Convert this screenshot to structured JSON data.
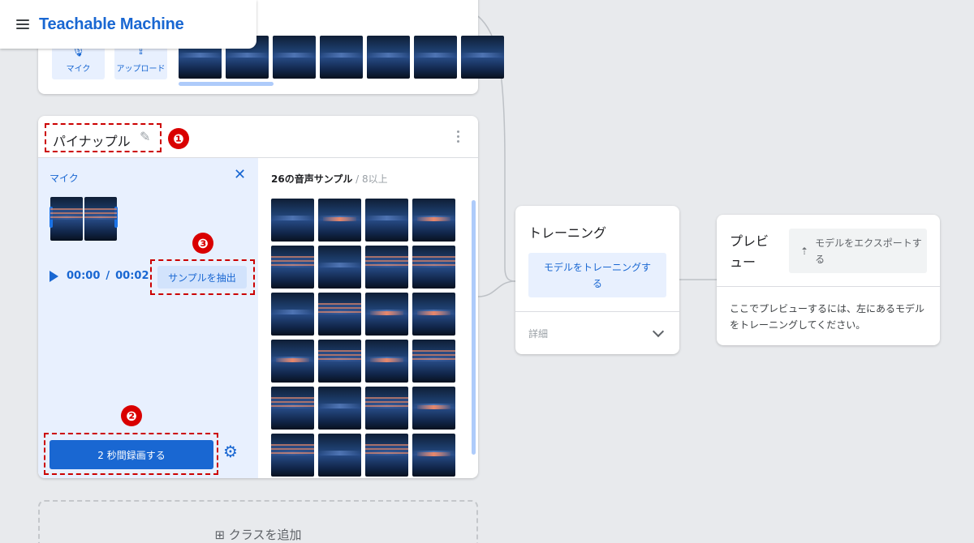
{
  "app": {
    "brand": "Teachable Machine"
  },
  "top_card": {
    "mic_label": "マイク",
    "upload_label": "アップロード",
    "mic_icon": "mic-icon",
    "upload_icon": "upload-icon"
  },
  "class_card": {
    "name": "パイナップル",
    "edit_icon": "pencil-icon",
    "mic_panel": {
      "label": "マイク",
      "close_icon": "close-icon",
      "time_current": "00:00",
      "time_sep": "/",
      "time_total": "00:02",
      "extract_label": "サンプルを抽出",
      "record_label": "2 秒間録画する",
      "settings_icon": "gear-icon"
    },
    "samples": {
      "count_label": "26の音声サンプル",
      "min_label": " / 8以上",
      "count": 26
    }
  },
  "add_class": {
    "label": "⊞  クラスを追加"
  },
  "training": {
    "title": "トレーニング",
    "button_label": "モデルをトレーニングする",
    "advanced_label": "詳細"
  },
  "preview": {
    "title": "プレビュー",
    "export_label": "モデルをエクスポートする",
    "hint": "ここでプレビューするには、左にあるモデルをトレーニングしてください。"
  },
  "annotations": [
    "❶",
    "❷",
    "❸"
  ],
  "colors": {
    "accent": "#1967d2",
    "accent_light": "#e8f0fe",
    "annotation_red": "#d90000",
    "background": "#e8eaed"
  }
}
